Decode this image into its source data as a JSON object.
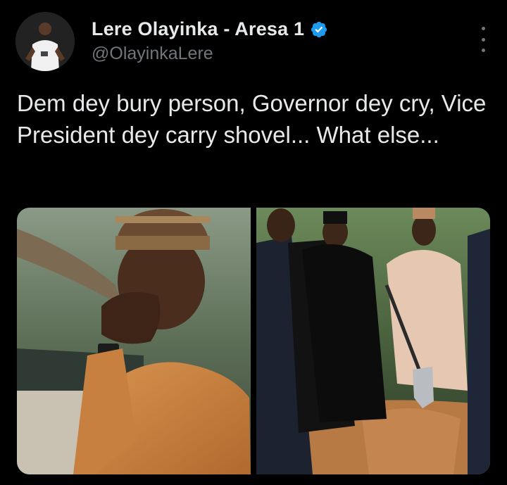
{
  "author": {
    "display_name": "Lere Olayinka - Aresa 1",
    "handle": "@OlayinkaLere",
    "verified": true,
    "verified_color": "#1d9bf0"
  },
  "tweet": {
    "text": "Dem dey bury person, Governor dey cry, Vice President dey carry shovel... What else..."
  },
  "media": {
    "photos": [
      {
        "label": "Man in embroidered cap covering his face, crying"
      },
      {
        "label": "Vice President holding a shovel at a burial site"
      }
    ]
  },
  "colors": {
    "background": "#000000",
    "text_primary": "#e7e9ea",
    "text_secondary": "#71767b"
  },
  "icons": {
    "verified": "verified-badge-icon",
    "more": "more-options-icon"
  }
}
